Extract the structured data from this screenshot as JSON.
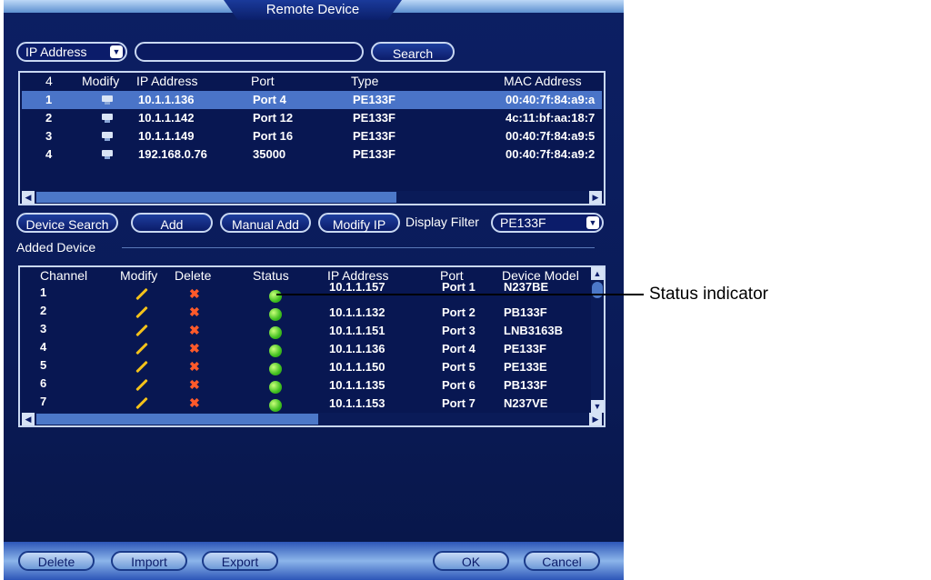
{
  "window": {
    "title": "Remote Device"
  },
  "search": {
    "filter_field": "IP Address",
    "query": "",
    "button": "Search"
  },
  "remote_table": {
    "count": "4",
    "headers": [
      "Modify",
      "IP Address",
      "Port",
      "Type",
      "MAC Address"
    ],
    "rows": [
      {
        "num": "1",
        "ip": "10.1.1.136",
        "port": "Port 4",
        "type": "PE133F",
        "mac": "00:40:7f:84:a9:a",
        "selected": true
      },
      {
        "num": "2",
        "ip": "10.1.1.142",
        "port": "Port 12",
        "type": "PE133F",
        "mac": "4c:11:bf:aa:18:7"
      },
      {
        "num": "3",
        "ip": "10.1.1.149",
        "port": "Port 16",
        "type": "PE133F",
        "mac": "00:40:7f:84:a9:5"
      },
      {
        "num": "4",
        "ip": "192.168.0.76",
        "port": "35000",
        "type": "PE133F",
        "mac": "00:40:7f:84:a9:2"
      }
    ]
  },
  "actions": {
    "device_search": "Device Search",
    "add": "Add",
    "manual_add": "Manual Add",
    "modify_ip": "Modify IP",
    "display_filter_label": "Display Filter",
    "display_filter_value": "PE133F"
  },
  "added_device": {
    "section_title": "Added Device",
    "headers": [
      "Channel",
      "Modify",
      "Delete",
      "Status",
      "IP Address",
      "Port",
      "Device Model"
    ],
    "rows": [
      {
        "channel": "1",
        "ip": "10.1.1.157",
        "port": "Port 1",
        "model": "N237BE"
      },
      {
        "channel": "2",
        "ip": "10.1.1.132",
        "port": "Port 2",
        "model": "PB133F"
      },
      {
        "channel": "3",
        "ip": "10.1.1.151",
        "port": "Port 3",
        "model": "LNB3163B"
      },
      {
        "channel": "4",
        "ip": "10.1.1.136",
        "port": "Port 4",
        "model": "PE133F"
      },
      {
        "channel": "5",
        "ip": "10.1.1.150",
        "port": "Port 5",
        "model": "PE133E"
      },
      {
        "channel": "6",
        "ip": "10.1.1.135",
        "port": "Port 6",
        "model": "PB133F"
      },
      {
        "channel": "7",
        "ip": "10.1.1.153",
        "port": "Port 7",
        "model": "N237VE"
      }
    ]
  },
  "footer": {
    "delete": "Delete",
    "import": "Import",
    "export": "Export",
    "ok": "OK",
    "cancel": "Cancel"
  },
  "annotation": {
    "status_indicator": "Status indicator"
  },
  "colors": {
    "status_online": "#3fbf1f",
    "panel_bg": "#0a1b58",
    "selection": "#4a74c8",
    "delete_x": "#ff5a2a",
    "modify_pencil": "#f4c21a"
  }
}
